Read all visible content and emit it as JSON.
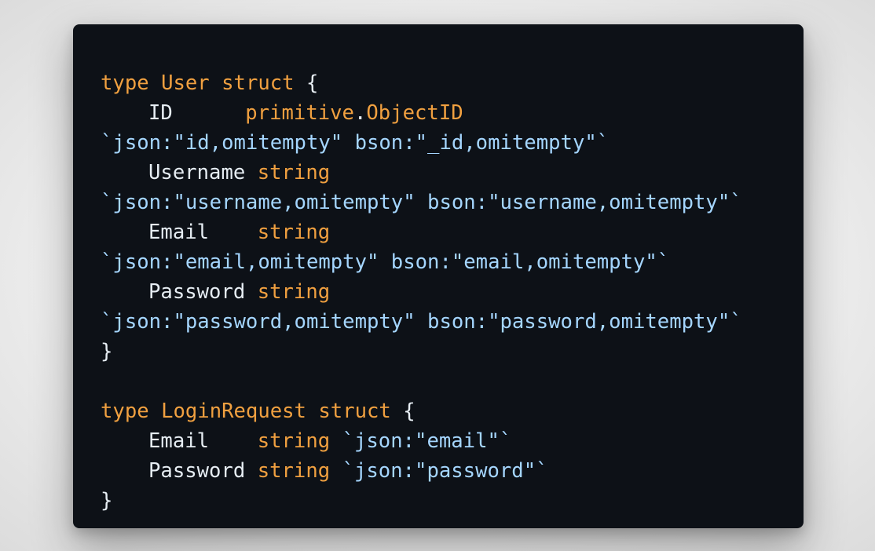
{
  "code": {
    "colors": {
      "background": "#0d1117",
      "keyword": "#f0a040",
      "type": "#f0a040",
      "field": "#e6edf3",
      "tag": "#a5d6ff"
    },
    "user_struct": {
      "decl": {
        "keyword": "type",
        "name": "User",
        "kind": "struct",
        "open": "{"
      },
      "id": {
        "name": "ID",
        "pad": "      ",
        "pkg": "primitive",
        "dot": ".",
        "type": "ObjectID"
      },
      "id_tag": "`json:\"id,omitempty\" bson:\"_id,omitempty\"`",
      "username": {
        "name": "Username",
        "type": "string"
      },
      "username_tag": "`json:\"username,omitempty\" bson:\"username,omitempty\"`",
      "email": {
        "name": "Email",
        "pad": "   ",
        "type": "string"
      },
      "email_tag": "`json:\"email,omitempty\" bson:\"email,omitempty\"`",
      "password": {
        "name": "Password",
        "type": "string"
      },
      "password_tag": "`json:\"password,omitempty\" bson:\"password,omitempty\"`",
      "close": "}"
    },
    "login_struct": {
      "decl": {
        "keyword": "type",
        "name": "LoginRequest",
        "kind": "struct",
        "open": "{"
      },
      "email": {
        "name": "Email",
        "pad": "   ",
        "type": "string",
        "tag": "`json:\"email\"`"
      },
      "password": {
        "name": "Password",
        "type": "string",
        "tag": "`json:\"password\"`"
      },
      "close": "}"
    }
  }
}
